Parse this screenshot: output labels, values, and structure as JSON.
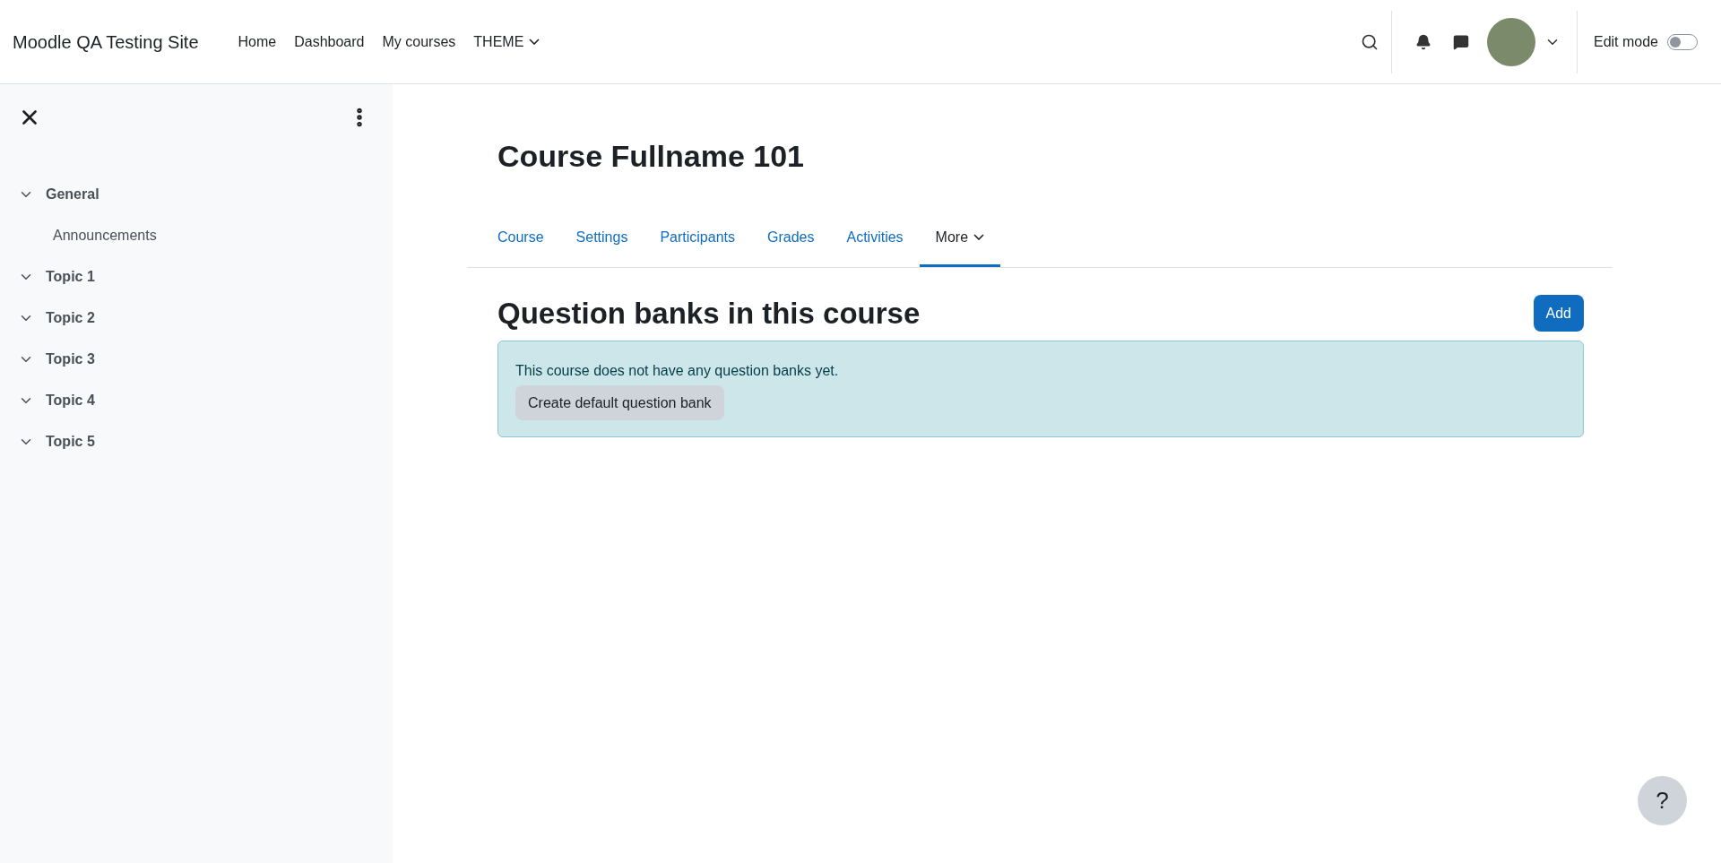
{
  "header": {
    "site_name": "Moodle QA Testing Site",
    "nav": [
      {
        "label": "Home",
        "has_menu": false
      },
      {
        "label": "Dashboard",
        "has_menu": false
      },
      {
        "label": "My courses",
        "has_menu": false
      },
      {
        "label": "THEME",
        "has_menu": true
      }
    ],
    "edit_mode": {
      "label": "Edit mode",
      "on": false
    }
  },
  "sidebar": {
    "sections": [
      {
        "label": "General",
        "expanded": true,
        "children": [
          {
            "label": "Announcements"
          }
        ]
      },
      {
        "label": "Topic 1",
        "expanded": true
      },
      {
        "label": "Topic 2",
        "expanded": true
      },
      {
        "label": "Topic 3",
        "expanded": true
      },
      {
        "label": "Topic 4",
        "expanded": true
      },
      {
        "label": "Topic 5",
        "expanded": true
      }
    ]
  },
  "course_title": "Course Fullname 101",
  "tabs": [
    {
      "label": "Course",
      "selected": false,
      "has_menu": false
    },
    {
      "label": "Settings",
      "selected": false,
      "has_menu": false
    },
    {
      "label": "Participants",
      "selected": false,
      "has_menu": false
    },
    {
      "label": "Grades",
      "selected": false,
      "has_menu": false
    },
    {
      "label": "Activities",
      "selected": false,
      "has_menu": false
    },
    {
      "label": "More",
      "selected": true,
      "has_menu": true
    }
  ],
  "page_heading": "Question banks in this course",
  "add_button": "Add",
  "alert": {
    "message": "This course does not have any question banks yet.",
    "button": "Create default question bank"
  },
  "help_button": "?"
}
